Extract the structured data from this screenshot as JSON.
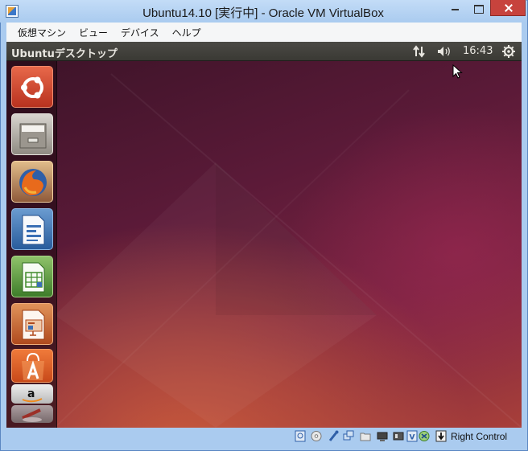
{
  "window": {
    "title": "Ubuntu14.10 [実行中] - Oracle VM VirtualBox"
  },
  "menu": {
    "items": [
      "仮想マシン",
      "ビュー",
      "デバイス",
      "ヘルプ"
    ]
  },
  "guest": {
    "panel_title": "Ubuntuデスクトップ",
    "clock": "16:43",
    "launcher_items": [
      "ubuntu-dash-icon",
      "files-icon",
      "firefox-icon",
      "writer-icon",
      "calc-icon",
      "impress-icon",
      "software-center-icon",
      "amazon-icon",
      "system-tools-icon"
    ]
  },
  "status": {
    "host_key": "Right Control"
  },
  "colors": {
    "frame": "#aacbef",
    "close_button": "#c7433d",
    "panel": "#3a3934",
    "launcher": "#2a0f1c",
    "desktop_accent": "#a83f3a"
  }
}
